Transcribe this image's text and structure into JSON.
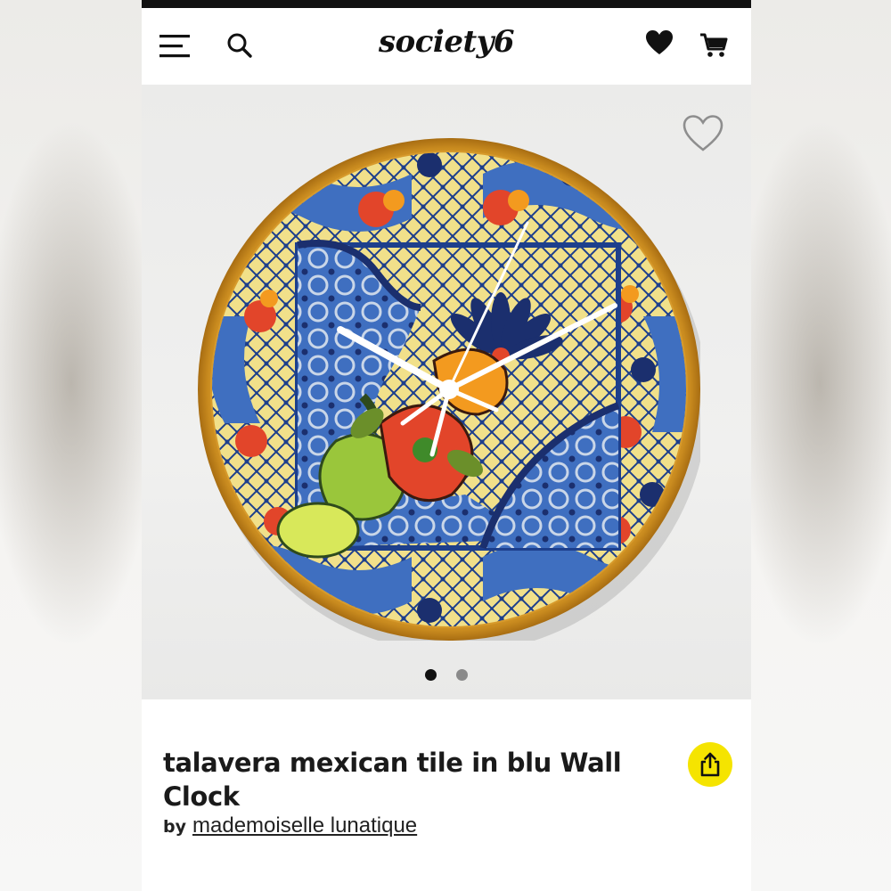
{
  "header": {
    "logo_text": "society6",
    "menu_icon": "hamburger-menu-icon",
    "search_icon": "search-icon",
    "wishlist_icon": "heart-icon",
    "cart_icon": "cart-icon"
  },
  "product": {
    "title": "talavera mexican tile in blu Wall Clock",
    "by_label": "by",
    "artist": "mademoiselle lunatique",
    "image_description_icon": "wall-clock-image",
    "favorite_icon": "heart-outline-icon",
    "share_icon": "share-icon",
    "carousel": {
      "total": 2,
      "active": 1
    }
  },
  "colors": {
    "accent_yellow": "#f5e400",
    "text": "#1a1a1a",
    "dot_active": "#111111",
    "dot_inactive": "#8a8a8a"
  }
}
